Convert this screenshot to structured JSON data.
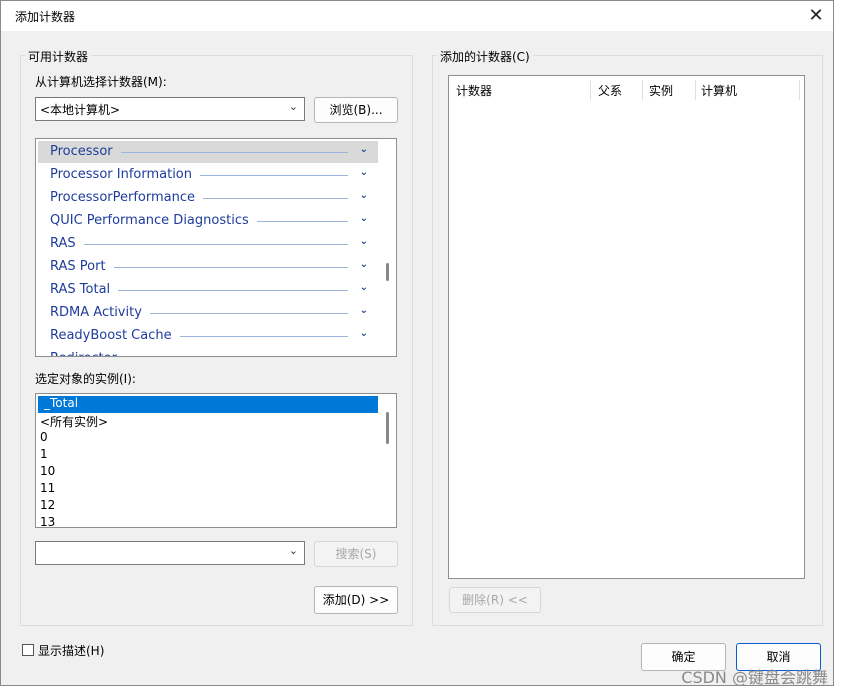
{
  "dialog": {
    "title": "添加计数器",
    "close_icon": "close-icon"
  },
  "available": {
    "group_label": "可用计数器",
    "from_computer_label": "从计算机选择计数器(M):",
    "computer_value": "<本地计算机>",
    "browse_label": "浏览(B)...",
    "counters": [
      "Processor",
      "Processor Information",
      "ProcessorPerformance",
      "QUIC Performance Diagnostics",
      "RAS",
      "RAS Port",
      "RAS Total",
      "RDMA Activity",
      "ReadyBoost Cache",
      "Redirector"
    ],
    "instances_label": "选定对象的实例(I):",
    "instances": [
      "_Total",
      "<所有实例>",
      "0",
      "1",
      "10",
      "11",
      "12",
      "13"
    ],
    "search_value": "",
    "search_label": "搜索(S)",
    "add_label": "添加(D) >>"
  },
  "added": {
    "group_label": "添加的计数器(C)",
    "columns": [
      "计数器",
      "父系",
      "实例",
      "计算机"
    ],
    "remove_label": "删除(R) <<"
  },
  "footer": {
    "show_desc_label": "显示描述(H)",
    "ok_label": "确定",
    "cancel_label": "取消"
  },
  "watermark": "CSDN @键盘会跳舞",
  "colors": {
    "selection": "#0078d7",
    "counter_text": "#1f3c9c",
    "hover_row": "#d9d9d9"
  }
}
